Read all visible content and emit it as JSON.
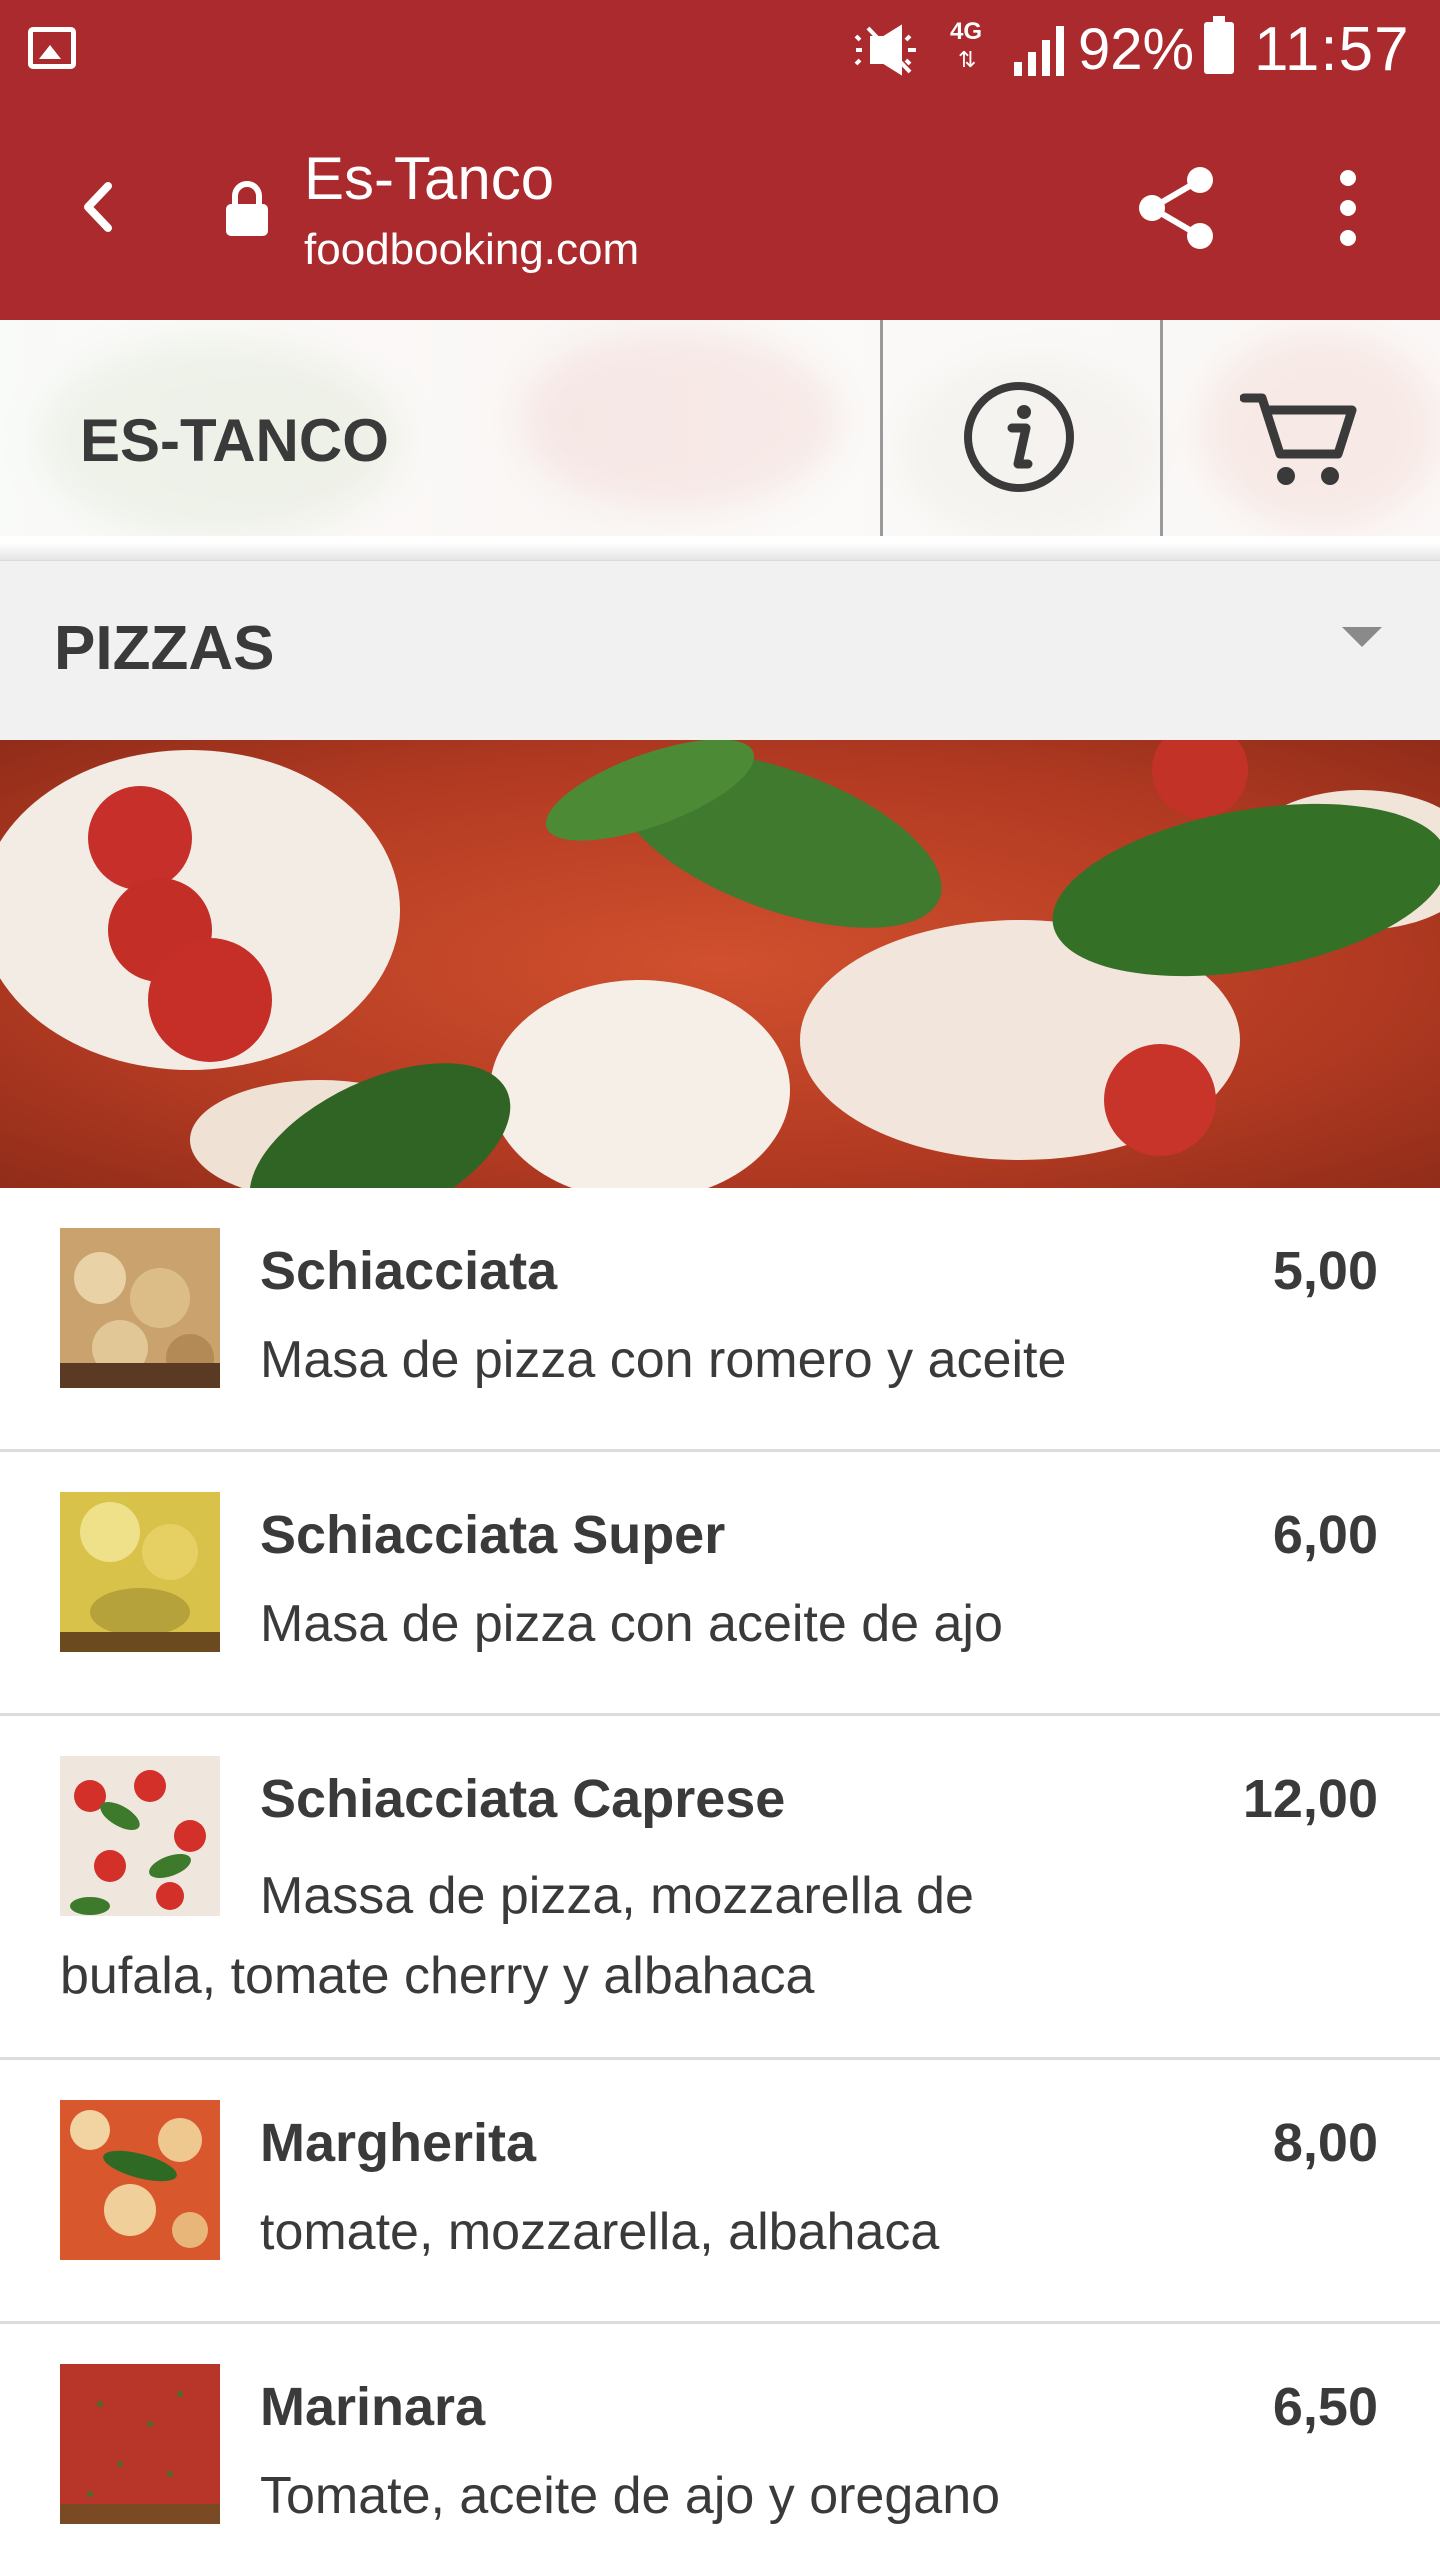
{
  "status_bar": {
    "network": "4G",
    "battery_percent": "92%",
    "time": "11:57",
    "icons": [
      "gallery-icon",
      "mute-icon",
      "network-arrows-icon",
      "signal-icon",
      "battery-icon"
    ]
  },
  "browser": {
    "title": "Es-Tanco",
    "url": "foodbooking.com",
    "icons": [
      "back-icon",
      "lock-icon",
      "share-icon",
      "more-vert-icon"
    ]
  },
  "restaurant": {
    "name": "ES-TANCO",
    "icons": [
      "info-icon",
      "cart-icon"
    ]
  },
  "category": {
    "selected": "PIZZAS",
    "icon": "dropdown-caret-icon"
  },
  "menu": {
    "items": [
      {
        "name": "Schiacciata",
        "price": "5,00",
        "description": "Masa de pizza con romero y aceite"
      },
      {
        "name": "Schiacciata Super",
        "price": "6,00",
        "description": "Masa de pizza con aceite de ajo"
      },
      {
        "name": "Schiacciata Caprese",
        "price": "12,00",
        "description": "Massa de pizza, mozzarella de bufala, tomate cherry y albahaca"
      },
      {
        "name": "Margherita",
        "price": "8,00",
        "description": "tomate, mozzarella, albahaca"
      },
      {
        "name": "Marinara",
        "price": "6,50",
        "description": "Tomate, aceite de ajo y oregano"
      }
    ]
  },
  "colors": {
    "brand_red": "#ab2a2e",
    "text": "#3a3a3a",
    "category_bg": "#f1f1f1",
    "divider": "#dcdcdc"
  }
}
